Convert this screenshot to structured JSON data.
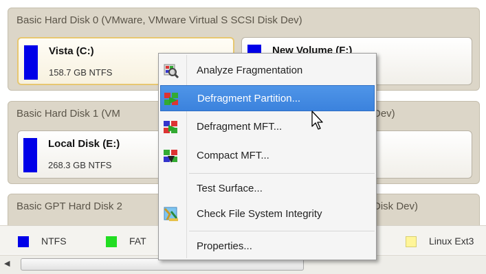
{
  "disks": [
    {
      "title": "Basic Hard Disk 0 (VMware, VMware Virtual S SCSI Disk Dev)",
      "partitions": [
        {
          "name": "Vista (C:)",
          "info": "158.7 GB NTFS",
          "color": "#0000e8",
          "selected": true
        },
        {
          "name": "New Volume (F:)",
          "info": "",
          "color": "#0000e8",
          "selected": false
        }
      ]
    },
    {
      "title": "Basic Hard Disk 1 (VM",
      "title_tail": "Dev)",
      "partitions": [
        {
          "name": "Local Disk (E:)",
          "info": "268.3 GB NTFS",
          "color": "#0000e8"
        }
      ]
    },
    {
      "title": "Basic GPT Hard Disk 2",
      "title_tail": "Disk Dev)"
    }
  ],
  "legend": [
    {
      "label": "NTFS",
      "color": "#0000e8"
    },
    {
      "label": "FAT",
      "color": "#22dd22"
    },
    {
      "label": "Linux Ext3",
      "color": "#fff599"
    }
  ],
  "context_menu": {
    "items": [
      {
        "label": "Analyze Fragmentation",
        "icon": "analyze-fragmentation-icon"
      },
      {
        "label": "Defragment Partition...",
        "icon": "defragment-partition-icon",
        "highlighted": true
      },
      {
        "label": "Defragment MFT...",
        "icon": "defragment-mft-icon"
      },
      {
        "label": "Compact MFT...",
        "icon": "compact-mft-icon"
      },
      {
        "label": "Test Surface..."
      },
      {
        "label": "Check File System Integrity",
        "icon": "check-integrity-icon"
      },
      {
        "label": "Properties..."
      }
    ]
  }
}
